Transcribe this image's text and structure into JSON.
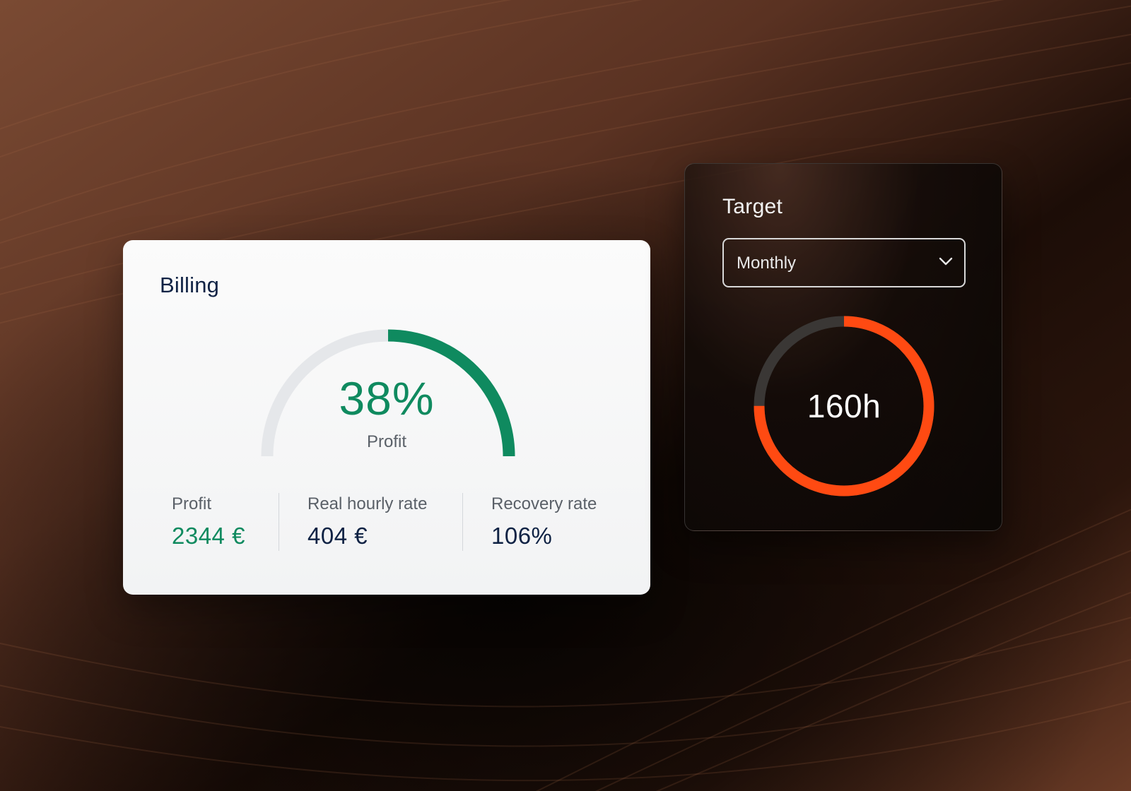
{
  "billing": {
    "title": "Billing",
    "gauge": {
      "value_label": "38%",
      "value_fraction": 0.38,
      "caption": "Profit"
    },
    "stats": [
      {
        "label": "Profit",
        "value": "2344 €"
      },
      {
        "label": "Real hourly rate",
        "value": "404 €"
      },
      {
        "label": "Recovery rate",
        "value": "106%"
      }
    ]
  },
  "target": {
    "title": "Target",
    "period_select": {
      "selected": "Monthly"
    },
    "ring": {
      "value_label": "160h",
      "progress_fraction": 0.75
    }
  },
  "colors": {
    "profit_green": "#0f8a5f",
    "gauge_track": "#e5e7ea",
    "navy_text": "#0f2244",
    "ring_orange": "#ff4a12",
    "ring_track": "#3a3735"
  },
  "icons": {
    "select_chevron": "chevron-down-icon"
  }
}
